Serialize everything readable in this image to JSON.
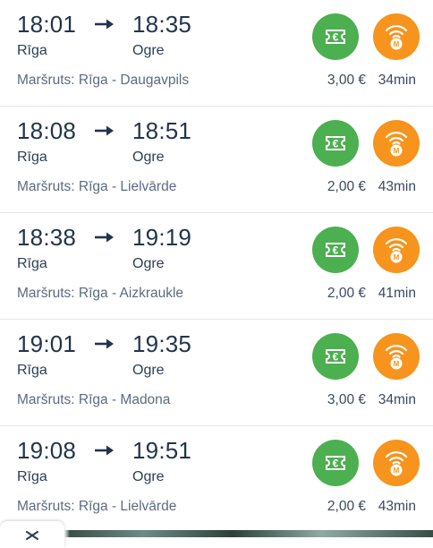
{
  "trips": [
    {
      "departure_time": "18:01",
      "arrival_time": "18:35",
      "from": "Rīga",
      "to": "Ogre",
      "route": "Maršruts: Rīga - Daugavpils",
      "price": "3,00 €",
      "duration": "34min"
    },
    {
      "departure_time": "18:08",
      "arrival_time": "18:51",
      "from": "Rīga",
      "to": "Ogre",
      "route": "Maršruts: Rīga - Lielvārde",
      "price": "2,00 €",
      "duration": "43min"
    },
    {
      "departure_time": "18:38",
      "arrival_time": "19:19",
      "from": "Rīga",
      "to": "Ogre",
      "route": "Maršruts: Rīga - Aizkraukle",
      "price": "2,00 €",
      "duration": "41min"
    },
    {
      "departure_time": "19:01",
      "arrival_time": "19:35",
      "from": "Rīga",
      "to": "Ogre",
      "route": "Maršruts: Rīga - Madona",
      "price": "3,00 €",
      "duration": "34min"
    },
    {
      "departure_time": "19:08",
      "arrival_time": "19:51",
      "from": "Rīga",
      "to": "Ogre",
      "route": "Maršruts: Rīga - Lielvārde",
      "price": "2,00 €",
      "duration": "43min"
    }
  ],
  "icons": {
    "arrow": "arrow-right-icon",
    "ticket": "euro-ticket-icon",
    "mobile": "mobile-ticket-icon",
    "close": "close-icon",
    "ticket_glyph": "€",
    "mobile_glyph": "M"
  },
  "colors": {
    "ticket_button": "#4caf50",
    "mobile_button": "#f7941d",
    "text_primary": "#22344d",
    "text_secondary": "#5c6b80"
  }
}
